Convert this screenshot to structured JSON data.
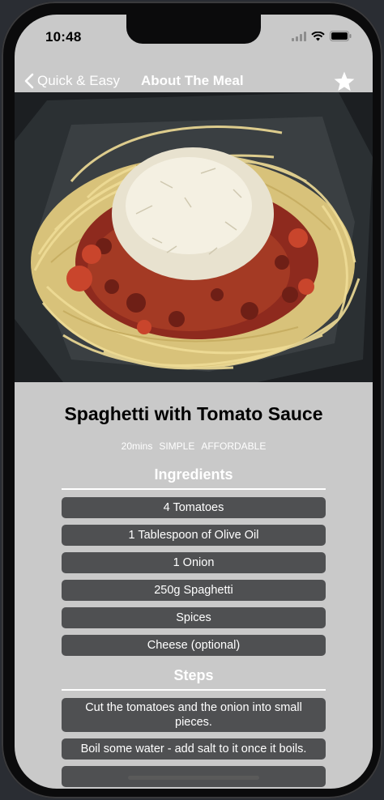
{
  "status_bar": {
    "time": "10:48"
  },
  "nav": {
    "back_label": "Quick & Easy",
    "title": "About The Meal",
    "star_icon": "star-icon"
  },
  "meal": {
    "title": "Spaghetti with Tomato Sauce",
    "duration": "20mins",
    "complexity": "SIMPLE",
    "affordability": "AFFORDABLE"
  },
  "ingredients": {
    "heading": "Ingredients",
    "items": [
      "4 Tomatoes",
      "1 Tablespoon of Olive Oil",
      "1 Onion",
      "250g Spaghetti",
      "Spices",
      "Cheese (optional)"
    ]
  },
  "steps": {
    "heading": "Steps",
    "items": [
      "Cut the tomatoes and the onion into small pieces.",
      "Boil some water - add salt to it once it boils.",
      ""
    ]
  },
  "colors": {
    "screen_bg": "#c9c9c9",
    "pill_bg": "#4f5052",
    "text_light": "#ffffff"
  }
}
